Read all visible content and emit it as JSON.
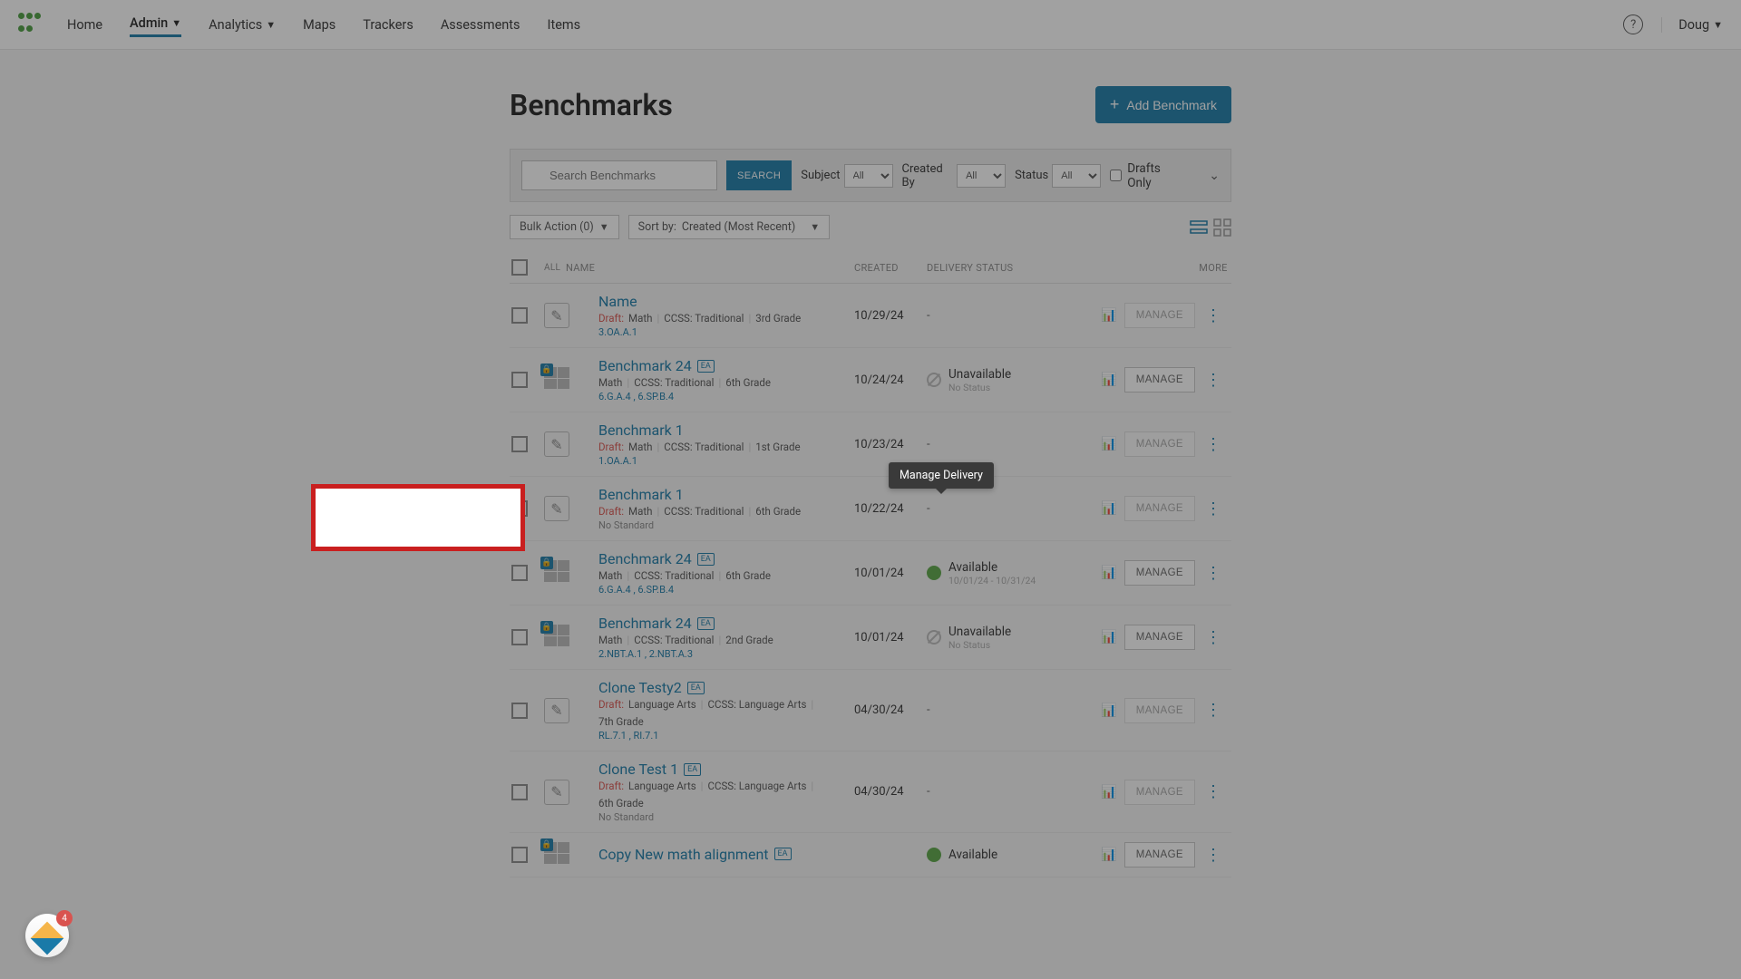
{
  "nav": {
    "items": [
      "Home",
      "Admin",
      "Analytics",
      "Maps",
      "Trackers",
      "Assessments",
      "Items"
    ],
    "active": "Admin",
    "user": "Doug"
  },
  "page": {
    "title": "Benchmarks",
    "add_label": "Add Benchmark"
  },
  "filters": {
    "search_placeholder": "Search Benchmarks",
    "search_btn": "SEARCH",
    "subject": {
      "label": "Subject",
      "value": "All"
    },
    "created_by": {
      "label": "Created By",
      "value": "All"
    },
    "status": {
      "label": "Status",
      "value": "All"
    },
    "drafts_only": "Drafts Only"
  },
  "bar": {
    "bulk": "Bulk Action (0)",
    "sort_label": "Sort by:",
    "sort_value": "Created (Most Recent)"
  },
  "th": {
    "all": "ALL",
    "name": "NAME",
    "created": "CREATED",
    "del": "DELIVERY STATUS",
    "more": "MORE"
  },
  "rows": [
    {
      "title": "Name",
      "draft": true,
      "subject": "Math",
      "standard": "CCSS: Traditional",
      "grade": "3rd Grade",
      "stds": "3.OA.A.1",
      "created": "10/29/24",
      "delivery": null,
      "ea": false,
      "locked": false
    },
    {
      "title": "Benchmark 24",
      "draft": false,
      "subject": "Math",
      "standard": "CCSS: Traditional",
      "grade": "6th Grade",
      "stds": "6.G.A.4 , 6.SP.B.4",
      "created": "10/24/24",
      "delivery": {
        "status": "Unavailable",
        "sub": "No Status"
      },
      "ea": true,
      "locked": true
    },
    {
      "title": "Benchmark 1",
      "draft": true,
      "subject": "Math",
      "standard": "CCSS: Traditional",
      "grade": "1st Grade",
      "stds": "1.OA.A.1",
      "created": "10/23/24",
      "delivery": null,
      "ea": false,
      "locked": false
    },
    {
      "title": "Benchmark 1",
      "draft": true,
      "subject": "Math",
      "standard": "CCSS: Traditional",
      "grade": "6th Grade",
      "stds": "No Standard",
      "created": "10/22/24",
      "delivery": null,
      "ea": false,
      "locked": false
    },
    {
      "title": "Benchmark 24",
      "draft": false,
      "subject": "Math",
      "standard": "CCSS: Traditional",
      "grade": "6th Grade",
      "stds": "6.G.A.4 , 6.SP.B.4",
      "created": "10/01/24",
      "delivery": {
        "status": "Available",
        "sub": "10/01/24 - 10/31/24"
      },
      "ea": true,
      "locked": true
    },
    {
      "title": "Benchmark 24",
      "draft": false,
      "subject": "Math",
      "standard": "CCSS: Traditional",
      "grade": "2nd Grade",
      "stds": "2.NBT.A.1 , 2.NBT.A.3",
      "created": "10/01/24",
      "delivery": {
        "status": "Unavailable",
        "sub": "No Status"
      },
      "ea": true,
      "locked": true
    },
    {
      "title": "Clone Testy2",
      "draft": true,
      "subject": "Language Arts",
      "standard": "CCSS: Language Arts",
      "grade": "7th Grade",
      "stds": "RL.7.1 , RI.7.1",
      "created": "04/30/24",
      "delivery": null,
      "ea": true,
      "locked": false
    },
    {
      "title": "Clone Test 1",
      "draft": true,
      "subject": "Language Arts",
      "standard": "CCSS: Language Arts",
      "grade": "6th Grade",
      "stds": "No Standard",
      "created": "04/30/24",
      "delivery": null,
      "ea": true,
      "locked": false
    },
    {
      "title": "Copy New math alignment",
      "draft": false,
      "subject": "",
      "standard": "",
      "grade": "",
      "stds": "",
      "created": "",
      "delivery": {
        "status": "Available",
        "sub": ""
      },
      "ea": true,
      "locked": true
    }
  ],
  "manage_label": "MANAGE",
  "draft_label": "Draft:",
  "tooltip": "Manage Delivery",
  "float_notif": "4"
}
